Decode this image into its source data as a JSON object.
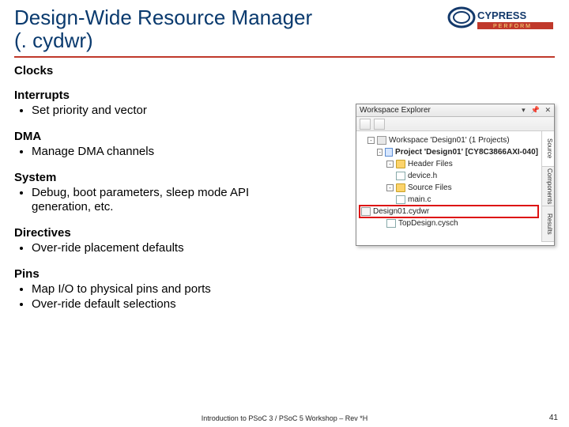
{
  "title_l1": "Design-Wide Resource Manager",
  "title_l2": "(. cydwr)",
  "logo": {
    "brand": "CYPRESS",
    "tag": "PERFORM"
  },
  "sections": [
    {
      "heading": "Clocks",
      "items": []
    },
    {
      "heading": "Interrupts",
      "items": [
        "Set priority and vector"
      ]
    },
    {
      "heading": "DMA",
      "items": [
        "Manage DMA channels"
      ]
    },
    {
      "heading": "System",
      "items": [
        "Debug, boot parameters, sleep mode API generation, etc."
      ]
    },
    {
      "heading": "Directives",
      "items": [
        "Over-ride placement defaults"
      ]
    },
    {
      "heading": "Pins",
      "items": [
        "Map I/O to physical pins and ports",
        "Over-ride default selections"
      ]
    }
  ],
  "ide": {
    "panel_title": "Workspace Explorer",
    "tabs": [
      "Source",
      "Components",
      "Results"
    ],
    "tree": {
      "workspace": "Workspace 'Design01' (1 Projects)",
      "project": "Project 'Design01' [CY8C3866AXI-040]",
      "folders": {
        "header": "Header Files",
        "device_h": "device.h",
        "source": "Source Files",
        "main_c": "main.c",
        "cydwr": "Design01.cydwr",
        "topsch": "TopDesign.cysch"
      }
    }
  },
  "footer": "Introduction to PSoC 3 / PSoC 5 Workshop – Rev *H",
  "page": "41"
}
